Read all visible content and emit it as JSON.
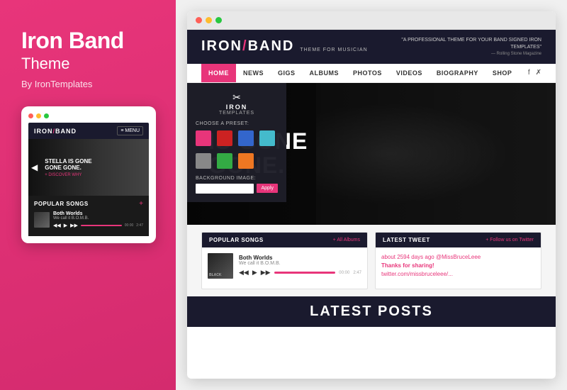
{
  "left": {
    "title": "Iron Band",
    "subtitle": "Theme",
    "by": "By IronTemplates"
  },
  "mobile": {
    "logo": "IRON",
    "logo_slash": "/",
    "logo_band": "BAND",
    "menu_label": "≡ MENU",
    "hero_headline_line1": "STELLA IS GONE",
    "hero_headline_line2": "GONE GONE.",
    "discover_label": "+ DISCOVER WHY",
    "songs_title": "POPULAR SONGS",
    "songs_plus": "+",
    "song1_name": "Both Worlds",
    "song1_sub": "We call it B.O.M.B.",
    "song1_time_start": "00:00",
    "song1_time_end": "2:47"
  },
  "browser": {
    "logo": "IRON",
    "logo_slash": "/",
    "logo_band": "BAND",
    "tagline": "THEME FOR MUSICIAN",
    "quote": "\"A PROFESSIONAL THEME FOR YOUR BAND SIGNED IRON TEMPLATES\"",
    "quote_source": "— Rolling Stone Magazine",
    "nav": {
      "items": [
        "HOME",
        "NEWS",
        "GIGS",
        "ALBUMS",
        "PHOTOS",
        "VIDEOS",
        "BIOGRAPHY",
        "SHOP"
      ]
    },
    "hero_headline_line1": "IS GONE",
    "hero_headline_line2": "GONE.",
    "preset_panel": {
      "logo_text": "IRON",
      "logo_sub": "TEMPLATES",
      "choose_label": "CHOOSE A PRESET:",
      "swatches_row1": [
        "#e8357a",
        "#cc2222",
        "#3366cc",
        "#44bbcc"
      ],
      "swatches_row2": [
        "#888888",
        "#33aa44",
        "#ee7722"
      ],
      "bg_image_label": "BACKGROUND IMAGE:",
      "apply_label": "Apply"
    },
    "popular_songs": {
      "title": "POPULAR SONGS",
      "link": "+ All Albums",
      "song1_name": "Both Worlds",
      "song1_sub": "We call it B.O.M.B.",
      "song1_time_start": "00:00",
      "song1_time_end": "2:47",
      "song1_album": "BLACK"
    },
    "latest_tweet": {
      "title": "LATEST TWEET",
      "link": "+ Follow us on Twitter",
      "tweet_ago": "about 2594 days ago",
      "tweet_handle": "@MissBruceLeee",
      "tweet_text": "Thanks for sharing!",
      "tweet_link": "twitter.com/missbruceleee/..."
    },
    "latest_posts_label": "LATEST POSTS"
  }
}
